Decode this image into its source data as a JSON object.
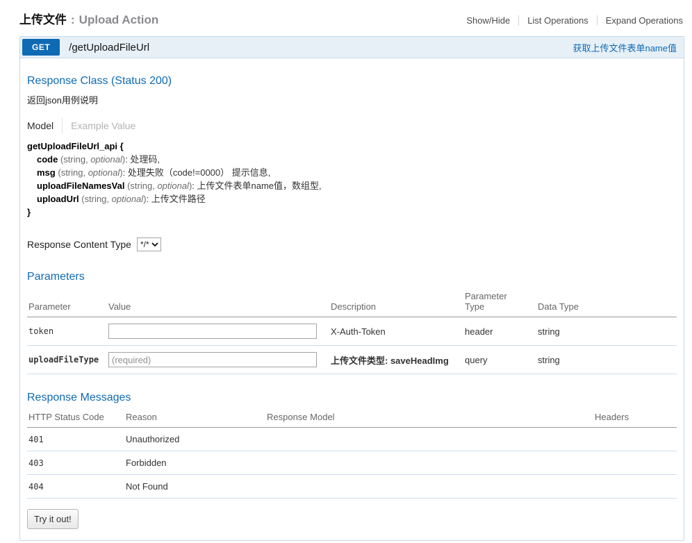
{
  "colors": {
    "accent": "#0f6ab4",
    "border": "#c3d9ec",
    "header_bg": "#e7f0f7"
  },
  "page": {
    "title_zh": "上传文件",
    "title_sep": ":",
    "title_en": "Upload Action",
    "nav": [
      {
        "label": "Show/Hide"
      },
      {
        "label": "List Operations"
      },
      {
        "label": "Expand Operations"
      }
    ]
  },
  "operation": {
    "method": "GET",
    "path": "/getUploadFileUrl",
    "summary": "获取上传文件表单name值"
  },
  "response_class": {
    "heading": "Response Class (Status 200)",
    "description": "返回json用例说明",
    "tabs": {
      "model": "Model",
      "example": "Example Value"
    },
    "model": {
      "open": "getUploadFileUrl_api {",
      "close": "}",
      "properties": [
        {
          "name": "code",
          "meta_pre": "(string, ",
          "meta_opt": "optional",
          "meta_post": ")",
          "desc": ": 处理码,"
        },
        {
          "name": "msg",
          "meta_pre": "(string, ",
          "meta_opt": "optional",
          "meta_post": ")",
          "desc": ": 处理失败（code!=0000） 提示信息,"
        },
        {
          "name": "uploadFileNamesVal",
          "meta_pre": "(string, ",
          "meta_opt": "optional",
          "meta_post": ")",
          "desc": ": 上传文件表单name值，数组型,"
        },
        {
          "name": "uploadUrl",
          "meta_pre": "(string, ",
          "meta_opt": "optional",
          "meta_post": ")",
          "desc": ": 上传文件路径"
        }
      ]
    },
    "content_type": {
      "label": "Response Content Type",
      "selected": "*/*"
    }
  },
  "parameters": {
    "heading": "Parameters",
    "columns": [
      "Parameter",
      "Value",
      "Description",
      "Parameter Type",
      "Data Type"
    ],
    "rows": [
      {
        "name": "token",
        "value": "",
        "placeholder": "",
        "description": "X-Auth-Token",
        "param_type": "header",
        "data_type": "string"
      },
      {
        "name": "uploadFileType",
        "value": "",
        "placeholder": "(required)",
        "description": "上传文件类型: saveHeadImg",
        "param_type": "query",
        "data_type": "string"
      }
    ]
  },
  "response_messages": {
    "heading": "Response Messages",
    "columns": [
      "HTTP Status Code",
      "Reason",
      "Response Model",
      "Headers"
    ],
    "rows": [
      {
        "code": "401",
        "reason": "Unauthorized"
      },
      {
        "code": "403",
        "reason": "Forbidden"
      },
      {
        "code": "404",
        "reason": "Not Found"
      }
    ]
  },
  "try_button": "Try it out!"
}
